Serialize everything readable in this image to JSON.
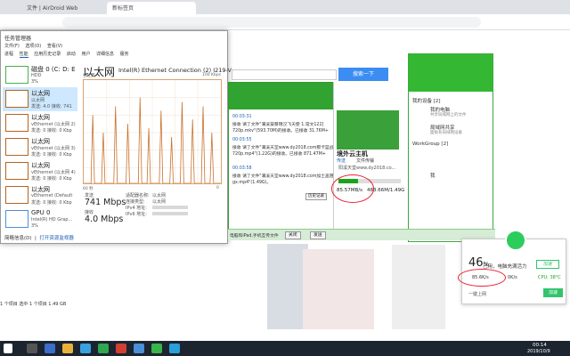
{
  "browser": {
    "tabs": [
      {
        "label": "文件 | AirDroid Web",
        "active": false
      },
      {
        "label": "新标签页",
        "active": true
      }
    ],
    "search_button": "搜索一下"
  },
  "task_manager": {
    "title": "任务管理器",
    "menu": [
      "文件(F)",
      "选项(O)",
      "查看(V)"
    ],
    "tabs": [
      "进程",
      "性能",
      "应用历史记录",
      "启动",
      "用户",
      "详细信息",
      "服务"
    ],
    "active_tab": "性能",
    "sidebar": [
      {
        "name": "磁盘 0 (C: D: E",
        "sub1": "HDD",
        "sub2": "3%",
        "kind": "disk"
      },
      {
        "name": "以太网",
        "sub1": "以太网",
        "sub2": "发送: 4.0 接收: 741",
        "kind": "eth",
        "selected": true
      },
      {
        "name": "以太网",
        "sub1": "vEthernet (以太网 2)",
        "sub2": "发送: 0 接收: 0 Kbp",
        "kind": "eth"
      },
      {
        "name": "以太网",
        "sub1": "vEthernet (以太网 3)",
        "sub2": "发送: 0 接收: 0 Kbp",
        "kind": "eth"
      },
      {
        "name": "以太网",
        "sub1": "vEthernet (以太网 4)",
        "sub2": "发送: 0 接收: 0 Kbp",
        "kind": "eth"
      },
      {
        "name": "以太网",
        "sub1": "vEthernet (Default",
        "sub2": "发送: 0 接收: 0 Kbp",
        "kind": "eth"
      },
      {
        "name": "GPU 0",
        "sub1": "Intel(R) HD Grap...",
        "sub2": "3%",
        "kind": "gpu"
      }
    ],
    "heading": "以太网",
    "adapter": "Intel(R) Ethernet Connection (2) I219-V",
    "graph_label_left": "吞吐量",
    "graph_label_right": "100 Kbps",
    "graph_axis_left": "60 秒",
    "graph_axis_right": "0",
    "stats": {
      "send_label": "发送",
      "send_value": "741 Mbps",
      "recv_label": "接收",
      "recv_value": "4.0 Mbps",
      "adapter_name_label": "适配器名称:",
      "adapter_name_value": "以太网",
      "conn_type_label": "连接类型:",
      "conn_type_value": "以太网",
      "ipv4_label": "IPv4 地址:",
      "ipv6_label": "IPv6 地址:"
    },
    "footer_brief": "简略信息(D)",
    "footer_monitor": "打开资源监视器",
    "status_strip": "1 个项目   选中 1 个项目  1.49 GB"
  },
  "chat": {
    "messages": [
      {
        "time": "00:03:31",
        "text": "接收 请了文件\"满溪穿暴锦汉飞天使 1.常文122]",
        "sub": "720p.mkv\"(593.70M)的接收。已接收 31.76M+"
      },
      {
        "time": "00:03:55",
        "text": "接收 请了文件\"满溪天堂www.dy2018.com那卡篮战舰",
        "sub": "720p.mp4\"(1.22G)的接收。已接收 871.47M+"
      },
      {
        "time": "00:03:58",
        "text": "接收 请了文件\"满溪天堂www.dy2018.com加士盖阻第",
        "sub": "gx.mp4\"(1.49G)。"
      }
    ],
    "history_button": "历史记录",
    "close_button": "关闭",
    "send_button": "发送(S)"
  },
  "transfer": {
    "title": "境外云主机",
    "tab_transfer": "传送",
    "tab_file": "文件传输",
    "filename": "阳溪天堂www.dy2018.co...",
    "speed": "85.57MB/s",
    "size": "483.66M/1.49G",
    "progress": 0.32
  },
  "qq_panel": {
    "section1": "我的设备 [2]",
    "item1": "我的电脑",
    "item1_sub": "共享局域网上的文件",
    "item2": "局域网共享",
    "item2_sub": "面板有局域网设备",
    "section2": "WorkGroup [2]",
    "item3": "我"
  },
  "bottom_strip": {
    "text": "电脑和iPad,手机互传文件",
    "close": "关闭",
    "send": "发送"
  },
  "widget": {
    "percent": "46",
    "unit": "%",
    "desc": "已用，电脑充满活力",
    "accelerate": "加速",
    "upload": "85.6K/s",
    "download": "0K/s",
    "cpu": "CPU: 38°C",
    "link": "一键上网",
    "button": "加速"
  },
  "taskbar": {
    "time": "00:14",
    "date": "2019/10/9"
  }
}
